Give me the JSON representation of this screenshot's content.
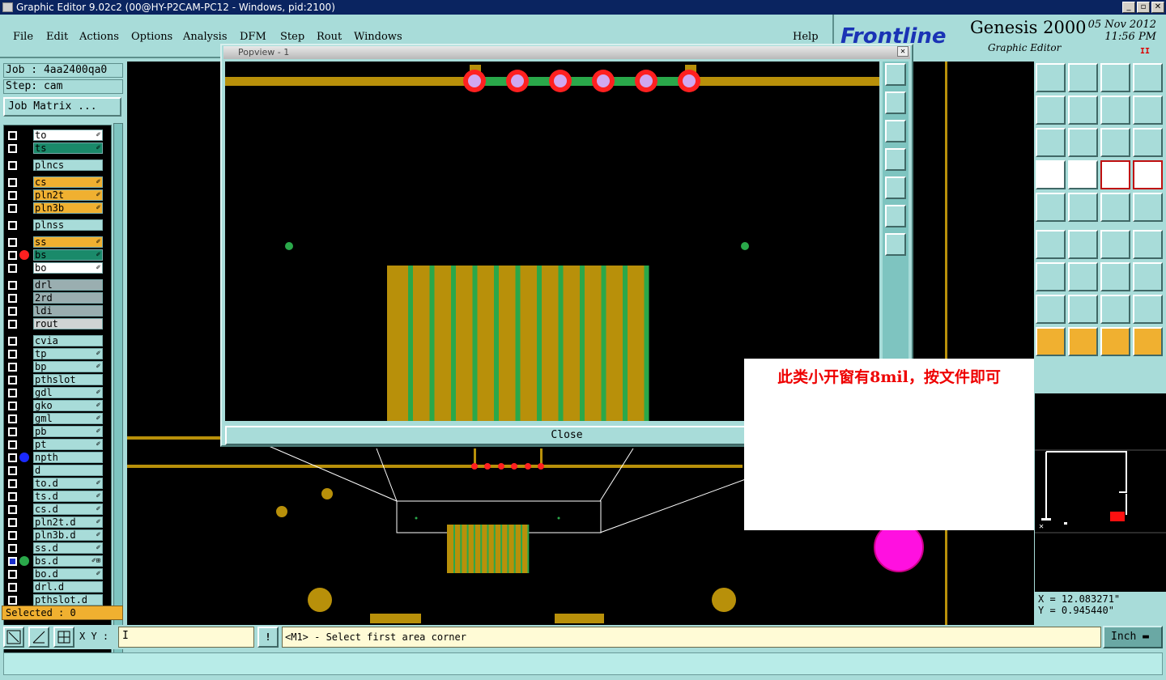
{
  "window": {
    "title": "Graphic Editor 9.02c2 (00@HY-P2CAM-PC12 - Windows, pid:2100)",
    "min": "_",
    "max": "▫",
    "close": "✕"
  },
  "menu": [
    "File",
    "Edit",
    "Actions",
    "Options",
    "Analysis",
    "DFM",
    "Step",
    "Rout",
    "Windows"
  ],
  "help_label": "Help",
  "brand": {
    "logo": "Frontline",
    "product": "Genesis 2000",
    "subtitle": "Graphic Editor",
    "date": "05 Nov 2012",
    "time": "11:56 PM",
    "pause": "II"
  },
  "job": {
    "job_label": "Job : 4aa2400qa0",
    "step_label": "Step: cam",
    "matrix_button": "Job Matrix ..."
  },
  "layers": [
    {
      "name": "to",
      "color": "#ffffff",
      "flag": "✐"
    },
    {
      "name": "ts",
      "color": "#1a8a6a",
      "flag": "✐"
    },
    {
      "name": "plncs",
      "color": "#a8dcd9",
      "flag": ""
    },
    {
      "name": "cs",
      "color": "#f0b030",
      "flag": "✐"
    },
    {
      "name": "pln2t",
      "color": "#f0b030",
      "flag": "✐"
    },
    {
      "name": "pln3b",
      "color": "#f0b030",
      "flag": "✐"
    },
    {
      "name": "plnss",
      "color": "#a8dcd9",
      "flag": ""
    },
    {
      "name": "ss",
      "color": "#f0b030",
      "flag": "✐"
    },
    {
      "name": "bs",
      "color": "#1a8a6a",
      "flag": "✐",
      "dot": "#ff2020"
    },
    {
      "name": "bo",
      "color": "#ffffff",
      "flag": "✐"
    },
    {
      "name": "drl",
      "color": "#9aaeb0",
      "flag": ""
    },
    {
      "name": "2rd",
      "color": "#9aaeb0",
      "flag": ""
    },
    {
      "name": "ldi",
      "color": "#9aaeb0",
      "flag": ""
    },
    {
      "name": "rout",
      "color": "#d0d4d4",
      "flag": ""
    },
    {
      "name": "cvia",
      "color": "#a8dcd9",
      "flag": ""
    },
    {
      "name": "tp",
      "color": "#a8dcd9",
      "flag": "✐"
    },
    {
      "name": "bp",
      "color": "#a8dcd9",
      "flag": "✐"
    },
    {
      "name": "pthslot",
      "color": "#a8dcd9",
      "flag": ""
    },
    {
      "name": "gdl",
      "color": "#a8dcd9",
      "flag": "✐"
    },
    {
      "name": "gko",
      "color": "#a8dcd9",
      "flag": "✐"
    },
    {
      "name": "gml",
      "color": "#a8dcd9",
      "flag": "✐"
    },
    {
      "name": "pb",
      "color": "#a8dcd9",
      "flag": "✐"
    },
    {
      "name": "pt",
      "color": "#a8dcd9",
      "flag": "✐"
    },
    {
      "name": "npth",
      "color": "#a8dcd9",
      "flag": "",
      "dot": "#1a2aff"
    },
    {
      "name": "d",
      "color": "#a8dcd9",
      "flag": ""
    },
    {
      "name": "to.d",
      "color": "#a8dcd9",
      "flag": "✐"
    },
    {
      "name": "ts.d",
      "color": "#a8dcd9",
      "flag": "✐"
    },
    {
      "name": "cs.d",
      "color": "#a8dcd9",
      "flag": "✐"
    },
    {
      "name": "pln2t.d",
      "color": "#a8dcd9",
      "flag": "✐"
    },
    {
      "name": "pln3b.d",
      "color": "#a8dcd9",
      "flag": "✐"
    },
    {
      "name": "ss.d",
      "color": "#a8dcd9",
      "flag": "✐"
    },
    {
      "name": "bs.d",
      "color": "#a8dcd9",
      "flag": "✐⊞",
      "dot": "#2aa84a",
      "checked": true
    },
    {
      "name": "bo.d",
      "color": "#a8dcd9",
      "flag": "✐"
    },
    {
      "name": "drl.d",
      "color": "#a8dcd9",
      "flag": ""
    },
    {
      "name": "pthslot.d",
      "color": "#a8dcd9",
      "flag": ""
    }
  ],
  "selected_label": "Selected : 0",
  "popview": {
    "title": "Popview - 1",
    "close_x": "✕",
    "close_button": "Close"
  },
  "note": "此类小开窗有8mil，按文件即可",
  "coords": {
    "x": "X = 12.083271\"",
    "y": "Y = 0.945440\""
  },
  "bottom": {
    "xy_label": "X Y :",
    "xy_value": "I",
    "warn": "!",
    "message": "<M1> - Select first area corner",
    "unit": "Inch"
  },
  "colors": {
    "copper": "#b8900a",
    "mask": "#2aa84a",
    "pad_ring": "#ff2020",
    "pad_fill": "#d0a8f0",
    "magenta": "#ff10e0"
  }
}
